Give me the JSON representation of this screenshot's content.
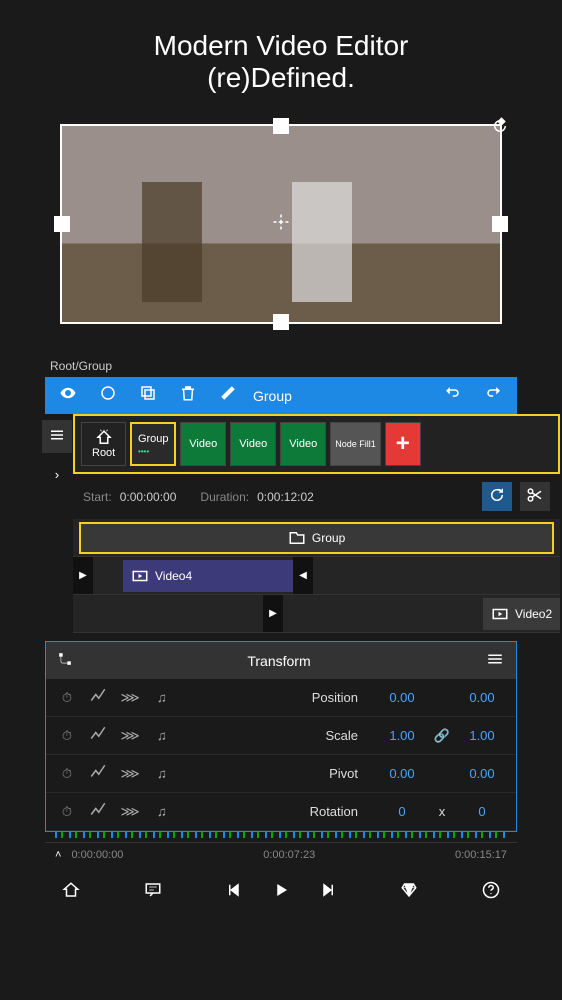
{
  "title_line1": "Modern Video Editor",
  "title_line2": "(re)Defined.",
  "breadcrumb": "Root/Group",
  "toolbar": {
    "group_label": "Group"
  },
  "layers": {
    "root_label": "Root",
    "group_label": "Group",
    "video1": "Video",
    "video2": "Video",
    "video3": "Video",
    "nodefill": "Node Fill1",
    "add": "+"
  },
  "timing": {
    "start_label": "Start:",
    "start_val": "0:00:00:00",
    "duration_label": "Duration:",
    "duration_val": "0:00:12:02"
  },
  "tracks": {
    "group": "Group",
    "video4": "Video4",
    "video2": "Video2"
  },
  "transform": {
    "title": "Transform",
    "rows": [
      {
        "label": "Position",
        "v1": "0.00",
        "v2": "0.00",
        "link": ""
      },
      {
        "label": "Scale",
        "v1": "1.00",
        "v2": "1.00",
        "link": "🔗"
      },
      {
        "label": "Pivot",
        "v1": "0.00",
        "v2": "0.00",
        "link": ""
      },
      {
        "label": "Rotation",
        "v1": "0",
        "v2": "0",
        "link": "x"
      }
    ]
  },
  "ruler": {
    "t1": "0:00:00:00",
    "t2": "0:00:07:23",
    "t3": "0:00:15:17"
  }
}
